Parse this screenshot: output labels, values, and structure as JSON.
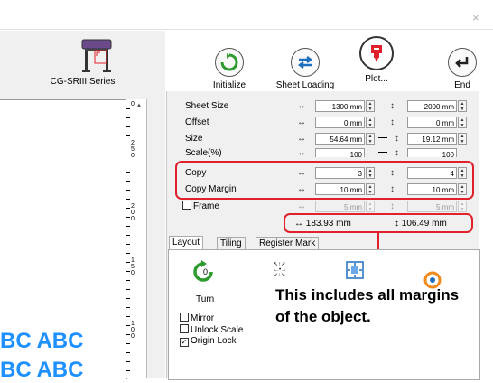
{
  "window": {
    "close_glyph": "×"
  },
  "device": {
    "label": "CG-SRIII Series"
  },
  "toolbar": {
    "initialize": "Initialize",
    "sheet_loading": "Sheet Loading",
    "plot": "Plot...",
    "end": "End"
  },
  "settings": {
    "sheet_size": {
      "label": "Sheet Size",
      "width": "1300 mm",
      "height": "2000 mm"
    },
    "offset": {
      "label": "Offset",
      "x": "0 mm",
      "y": "0 mm"
    },
    "size": {
      "label": "Size",
      "width": "54.64 mm",
      "height": "19.12 mm"
    },
    "scale": {
      "label": "Scale(%)",
      "x": "100",
      "y": "100"
    },
    "copy": {
      "label": "Copy",
      "x": "3",
      "y": "4"
    },
    "copy_margin": {
      "label": "Copy Margin",
      "x": "10 mm",
      "y": "10 mm"
    },
    "frame": {
      "label": "Frame",
      "x": "5 mm",
      "y": "5 mm"
    },
    "totals": {
      "width": "↔ 183.93 mm",
      "height": "↕ 106.49 mm"
    }
  },
  "symbols": {
    "horiz": "↔",
    "vert": "↕",
    "link": "—"
  },
  "tabs": [
    {
      "label": "Layout"
    },
    {
      "label": "Tiling"
    },
    {
      "label": "Register Mark"
    }
  ],
  "layout": {
    "turn_value": "0",
    "turn_label": "Turn",
    "mirror": "Mirror",
    "unlock_scale": "Unlock Scale",
    "origin_lock": "Origin Lock"
  },
  "preview": {
    "text_line": "BC ABC",
    "ruler_labels": [
      "0",
      "250",
      "200",
      "150",
      "100"
    ]
  },
  "annotation": {
    "text": "This includes all margins of the object."
  },
  "colors": {
    "highlight": "#e0202a",
    "preview_text": "#1e90ff",
    "accent_green": "#2e9b2e",
    "accent_blue": "#1e6fc0"
  }
}
